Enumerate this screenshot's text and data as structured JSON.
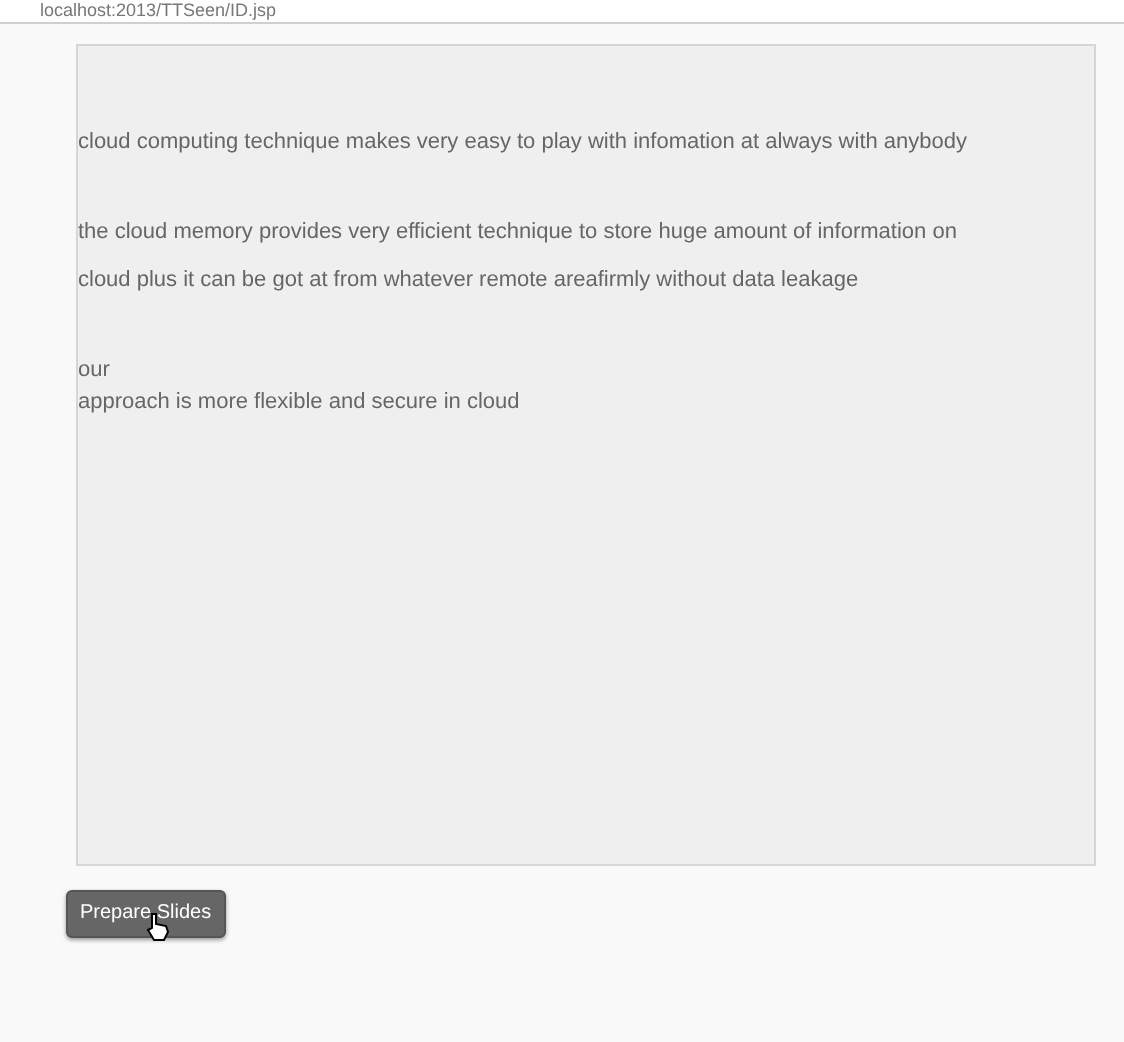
{
  "address_bar": {
    "url": "localhost:2013/TTSeen/ID.jsp"
  },
  "text_area": {
    "paragraphs": [
      [
        "cloud computing technique makes very easy to play with infomation at always with anybody"
      ],
      [
        "the cloud memory provides very efficient technique to store huge amount of information on",
        "cloud plus it can be got at from whatever remote areafirmly without data leakage"
      ],
      [
        "our",
        "approach is more flexible and secure in cloud"
      ]
    ]
  },
  "button": {
    "label": "Prepare Slides"
  }
}
